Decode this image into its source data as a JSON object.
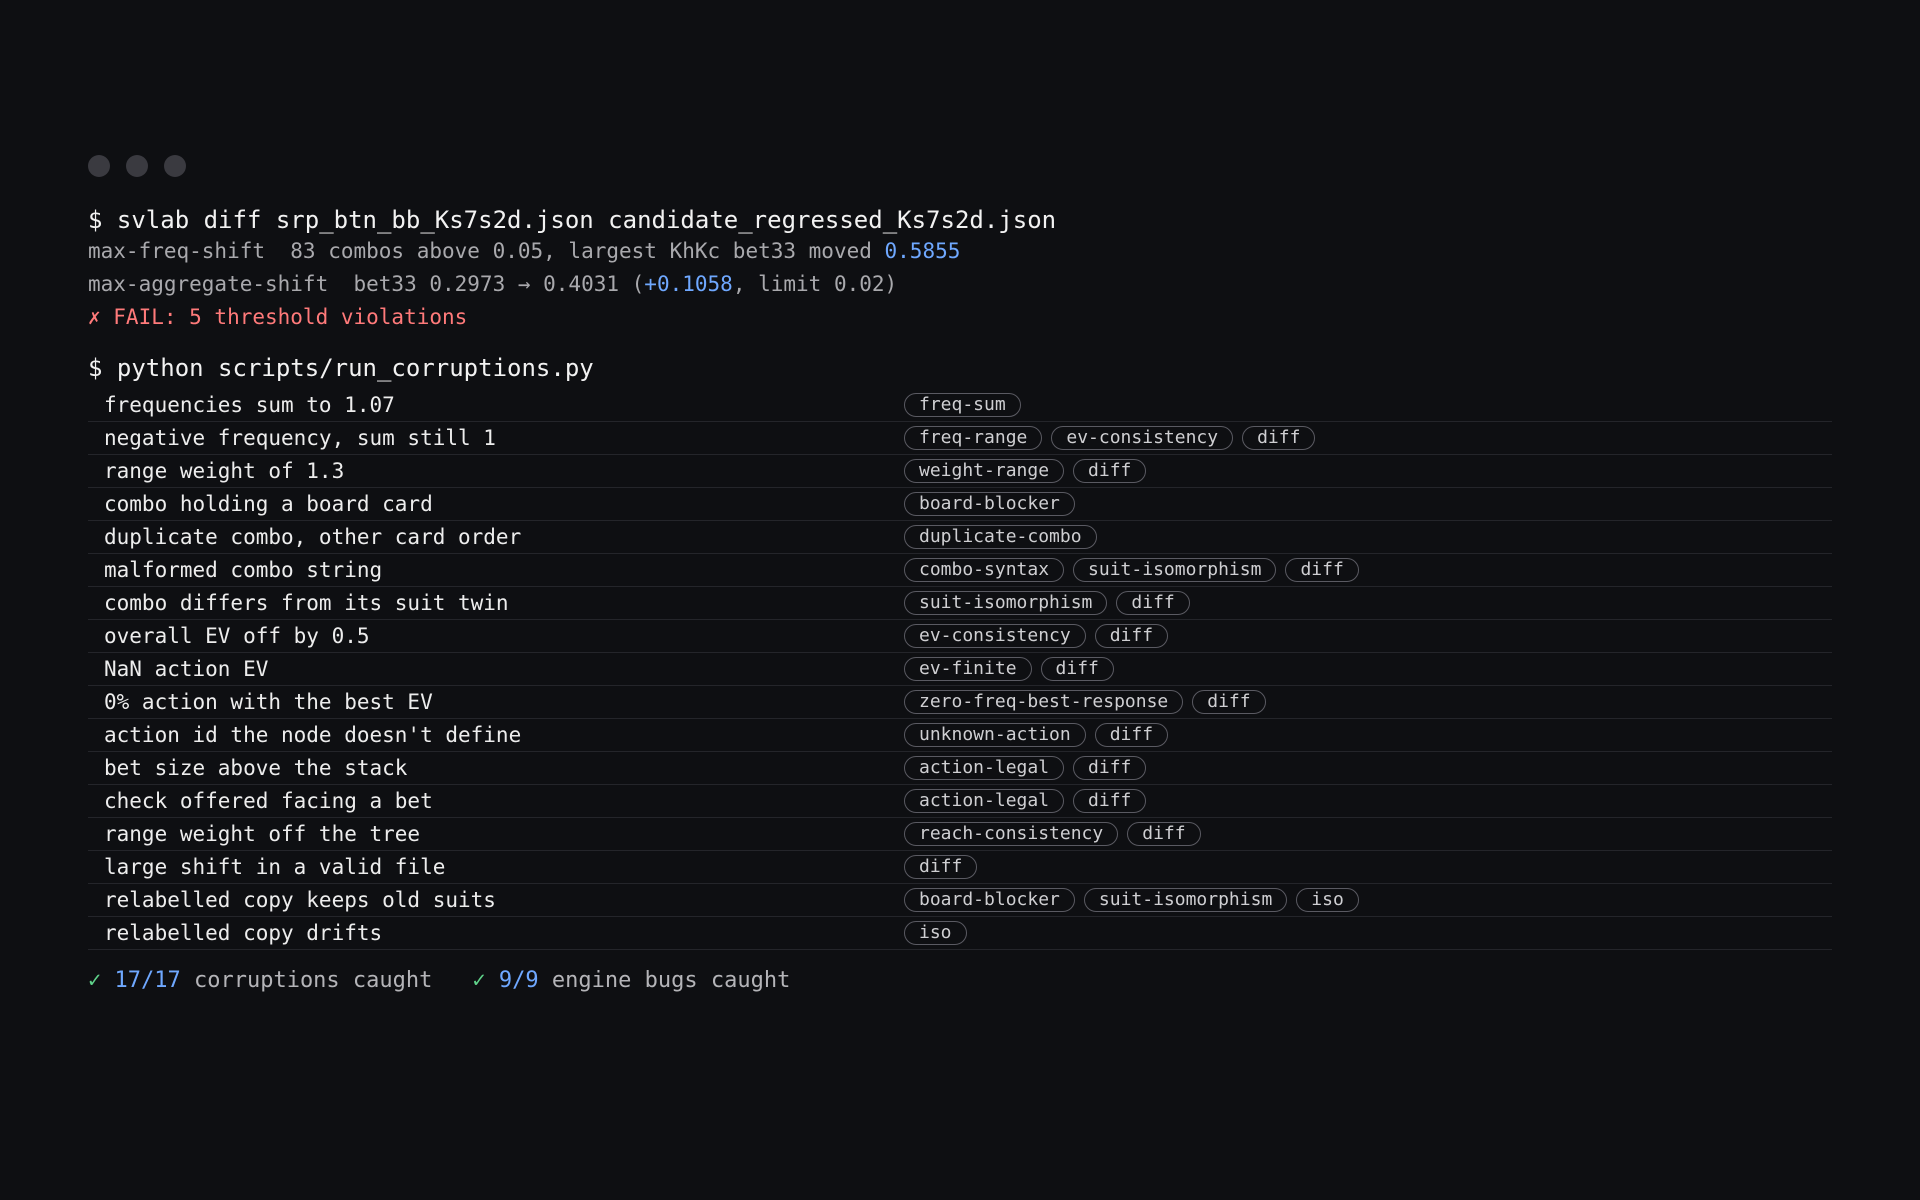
{
  "window": {
    "dots": [
      "close",
      "minimize",
      "maximize"
    ]
  },
  "block1": {
    "command": "$ svlab diff srp_btn_bb_Ks7s2d.json candidate_regressed_Ks7s2d.json",
    "line1_prefix": "max-freq-shift  83 combos above 0.05, largest KhKc bet33 moved ",
    "line1_value": "0.5855",
    "line2_prefix": "max-aggregate-shift  bet33 0.2973 → 0.4031 (",
    "line2_value": "+0.1058",
    "line2_suffix": ", limit 0.02)",
    "fail": "✗ FAIL: 5 threshold violations"
  },
  "block2": {
    "command": "$ python scripts/run_corruptions.py",
    "rows": [
      {
        "label": "frequencies sum to 1.07",
        "tags": [
          "freq-sum"
        ]
      },
      {
        "label": "negative frequency, sum still 1",
        "tags": [
          "freq-range",
          "ev-consistency",
          "diff"
        ]
      },
      {
        "label": "range weight of 1.3",
        "tags": [
          "weight-range",
          "diff"
        ]
      },
      {
        "label": "combo holding a board card",
        "tags": [
          "board-blocker"
        ]
      },
      {
        "label": "duplicate combo, other card order",
        "tags": [
          "duplicate-combo"
        ]
      },
      {
        "label": "malformed combo string",
        "tags": [
          "combo-syntax",
          "suit-isomorphism",
          "diff"
        ]
      },
      {
        "label": "combo differs from its suit twin",
        "tags": [
          "suit-isomorphism",
          "diff"
        ]
      },
      {
        "label": "overall EV off by 0.5",
        "tags": [
          "ev-consistency",
          "diff"
        ]
      },
      {
        "label": "NaN action EV",
        "tags": [
          "ev-finite",
          "diff"
        ]
      },
      {
        "label": "0% action with the best EV",
        "tags": [
          "zero-freq-best-response",
          "diff"
        ]
      },
      {
        "label": "action id the node doesn't define",
        "tags": [
          "unknown-action",
          "diff"
        ]
      },
      {
        "label": "bet size above the stack",
        "tags": [
          "action-legal",
          "diff"
        ]
      },
      {
        "label": "check offered facing a bet",
        "tags": [
          "action-legal",
          "diff"
        ]
      },
      {
        "label": "range weight off the tree",
        "tags": [
          "reach-consistency",
          "diff"
        ]
      },
      {
        "label": "large shift in a valid file",
        "tags": [
          "diff"
        ]
      },
      {
        "label": "relabelled copy keeps old suits",
        "tags": [
          "board-blocker",
          "suit-isomorphism",
          "iso"
        ]
      },
      {
        "label": "relabelled copy drifts",
        "tags": [
          "iso"
        ]
      }
    ]
  },
  "summary": {
    "check1": "✓",
    "count1": "17/17",
    "text1": " corruptions caught",
    "check2": "✓",
    "count2": "9/9",
    "text2": " engine bugs caught"
  }
}
